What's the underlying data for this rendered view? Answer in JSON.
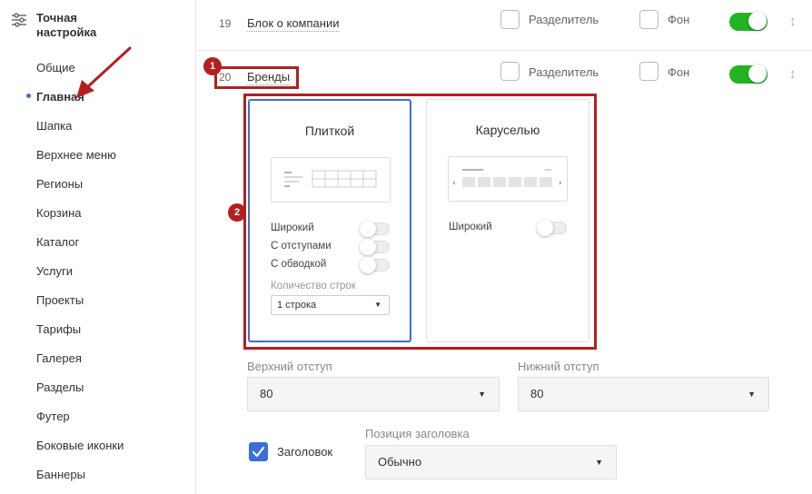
{
  "sidebar": {
    "title": "Точная настройка",
    "icon": "sliders-icon",
    "items": [
      "Общие",
      "Главная",
      "Шапка",
      "Верхнее меню",
      "Регионы",
      "Корзина",
      "Каталог",
      "Услуги",
      "Проекты",
      "Тарифы",
      "Галерея",
      "Разделы",
      "Футер",
      "Боковые иконки",
      "Баннеры"
    ],
    "active_index": 1
  },
  "rows": [
    {
      "num": "19",
      "name": "Блок о компании",
      "separator_label": "Разделитель",
      "background_label": "Фон",
      "enabled": true
    },
    {
      "num": "20",
      "name": "Бренды",
      "separator_label": "Разделитель",
      "background_label": "Фон",
      "enabled": true
    }
  ],
  "annotations": {
    "badge1": "1",
    "badge2": "2",
    "color": "#b31f1f"
  },
  "cards": {
    "tile": {
      "title": "Плиткой",
      "options": [
        "Широкий",
        "С отступами",
        "С обводкой"
      ],
      "rows_label": "Количество строк",
      "rows_value": "1 строка"
    },
    "carousel": {
      "title": "Каруселью",
      "options": [
        "Широкий"
      ]
    }
  },
  "padding": {
    "top_label": "Верхний отступ",
    "top_value": "80",
    "bottom_label": "Нижний отступ",
    "bottom_value": "80"
  },
  "heading": {
    "checkbox_label": "Заголовок",
    "checked": true,
    "position_label": "Позиция заголовка",
    "position_value": "Обычно"
  },
  "colors": {
    "accent": "#3b6fd6",
    "toggle_on": "#22b422"
  }
}
